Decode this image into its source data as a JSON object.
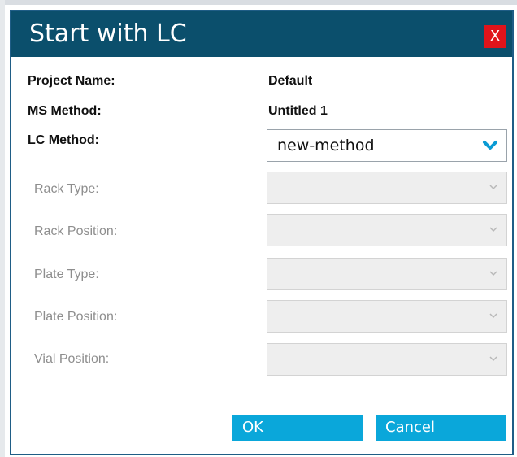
{
  "dialog": {
    "title": "Start with LC",
    "close_label": "X"
  },
  "fields": {
    "project_name": {
      "label": "Project Name:",
      "value": "Default"
    },
    "ms_method": {
      "label": "MS Method:",
      "value": "Untitled 1"
    },
    "lc_method": {
      "label": "LC Method:",
      "value": "new-method"
    },
    "rack_type": {
      "label": "Rack Type:",
      "value": ""
    },
    "rack_position": {
      "label": "Rack Position:",
      "value": ""
    },
    "plate_type": {
      "label": "Plate Type:",
      "value": ""
    },
    "plate_position": {
      "label": "Plate Position:",
      "value": ""
    },
    "vial_position": {
      "label": "Vial Position:",
      "value": ""
    }
  },
  "buttons": {
    "ok": "OK",
    "cancel": "Cancel"
  },
  "colors": {
    "titlebar": "#0b4f6c",
    "close": "#e0141b",
    "button": "#0aa7da",
    "chevron_active": "#0a9bd4"
  },
  "icons": {
    "lc_method_chevron": "chevron-down-icon",
    "disabled_chevron": "chevron-down-icon"
  }
}
